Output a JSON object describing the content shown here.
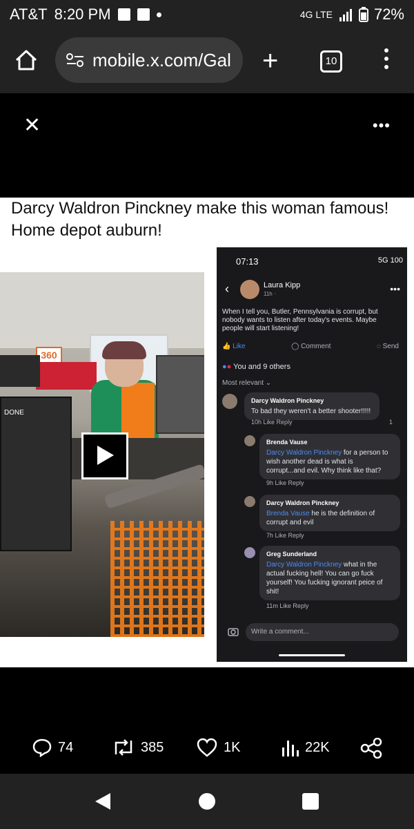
{
  "status_bar": {
    "carrier": "AT&T",
    "time": "8:20 PM",
    "network": "4G LTE",
    "battery": "72%"
  },
  "browser": {
    "url": "mobile.x.com/Gal",
    "tab_count": "10"
  },
  "post": {
    "caption": "Darcy Waldron Pinckney make this woman famous! Home depot auburn!",
    "video_sign": "360",
    "video_sign2": "DONE"
  },
  "screenshot": {
    "time": "07:13",
    "status": "5G 100",
    "author": "Laura Kipp",
    "author_sub": "11h ·",
    "post_text": "When I tell you, Butler, Pennsylvania is corrupt, but nobody wants to listen after today's events. Maybe people will  start listening!",
    "like": "Like",
    "comment": "Comment",
    "send": "Send",
    "reactions": "You and 9 others",
    "sort": "Most relevant ⌄",
    "comments": [
      {
        "name": "Darcy Waldron Pinckney",
        "mention": "",
        "text": "To bad they weren't a better shooter!!!!!",
        "meta": "10h   Like   Reply",
        "count": "1"
      },
      {
        "name": "Brenda Vause",
        "mention": "Darcy Waldron Pinckney",
        "text": " for a person to wish another dead is what is corrupt...and evil. Why think like that?",
        "meta": "9h   Like   Reply",
        "count": ""
      },
      {
        "name": "Darcy Waldron Pinckney",
        "mention": "Brenda Vause",
        "text": " he is the definition of corrupt and evil",
        "meta": "7h   Like   Reply",
        "count": ""
      },
      {
        "name": "Greg Sunderland",
        "mention": "Darcy Waldron Pinckney",
        "text": " what in the actual fucking hell! You can go fuck yourself! You fucking ignorant peice of shit!",
        "meta": "11m   Like   Reply",
        "count": ""
      }
    ],
    "input_placeholder": "Write a comment..."
  },
  "actions": {
    "replies": "74",
    "reposts": "385",
    "likes": "1K",
    "views": "22K"
  },
  "colors": {
    "accent": "#4b8bf5",
    "bg": "#000000"
  }
}
